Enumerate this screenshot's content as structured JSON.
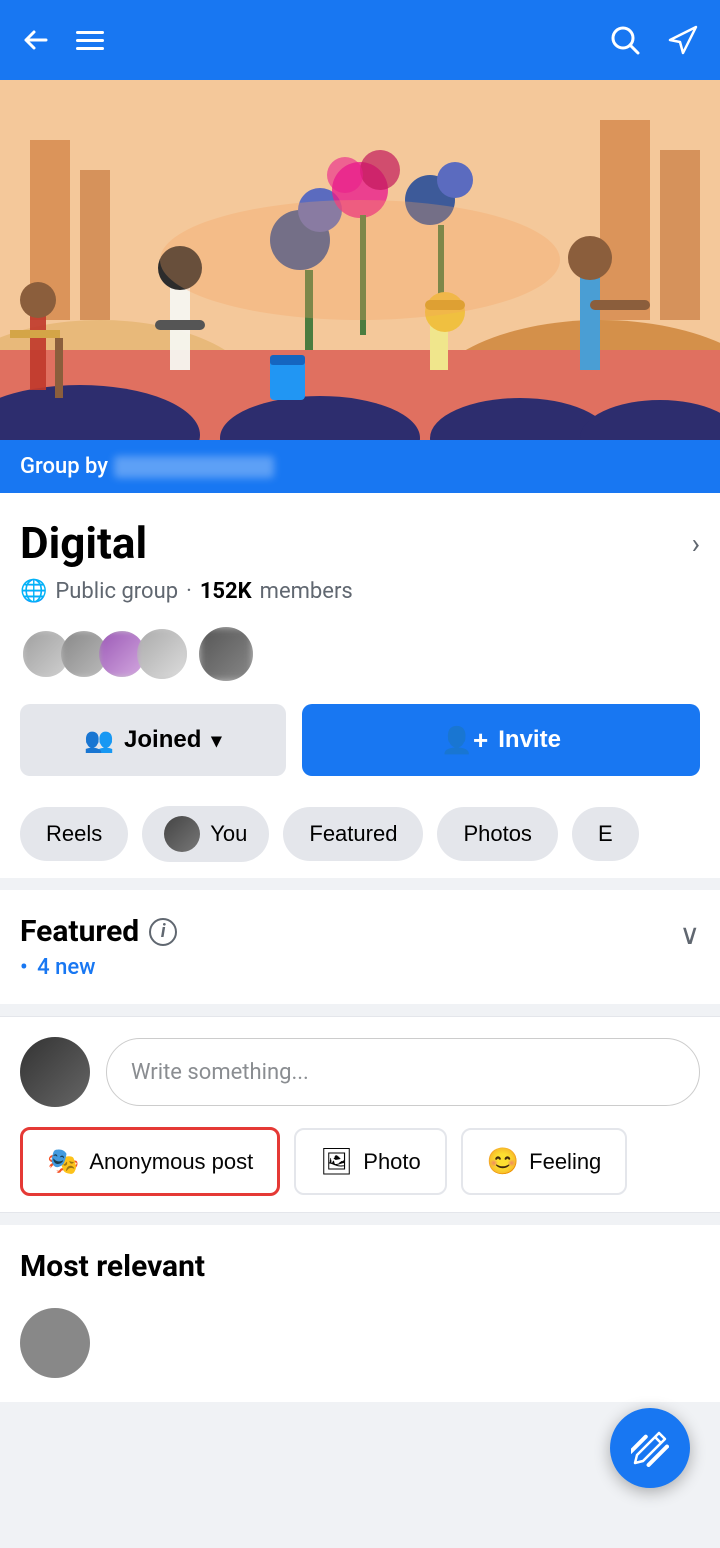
{
  "nav": {
    "back_label": "←",
    "menu_label": "Menu",
    "search_label": "Search",
    "share_label": "Share"
  },
  "cover": {
    "alt": "Group cover illustration"
  },
  "group_by_bar": {
    "label": "Group by",
    "blurred": "██████"
  },
  "group_info": {
    "title": "Digital",
    "type": "Public group",
    "member_count": "152K",
    "members_label": "members"
  },
  "buttons": {
    "joined_label": "Joined",
    "invite_label": "Invite"
  },
  "filter_tabs": [
    {
      "id": "reels",
      "label": "Reels",
      "has_avatar": false
    },
    {
      "id": "you",
      "label": "You",
      "has_avatar": true
    },
    {
      "id": "featured",
      "label": "Featured",
      "has_avatar": false
    },
    {
      "id": "photos",
      "label": "Photos",
      "has_avatar": false
    },
    {
      "id": "more",
      "label": "E...",
      "has_avatar": false
    }
  ],
  "featured": {
    "title": "Featured",
    "info_label": "i",
    "new_count": "4 new",
    "new_prefix": "•",
    "chevron": "∨"
  },
  "post_input": {
    "placeholder": "Write something..."
  },
  "post_actions": [
    {
      "id": "anonymous",
      "label": "Anonymous post",
      "icon": "🎭"
    },
    {
      "id": "photo",
      "label": "Photo",
      "icon": "🖼"
    },
    {
      "id": "feeling",
      "label": "Feeling",
      "icon": "😊"
    }
  ],
  "most_relevant": {
    "title": "Most relevant"
  },
  "fab": {
    "icon": "✏"
  }
}
